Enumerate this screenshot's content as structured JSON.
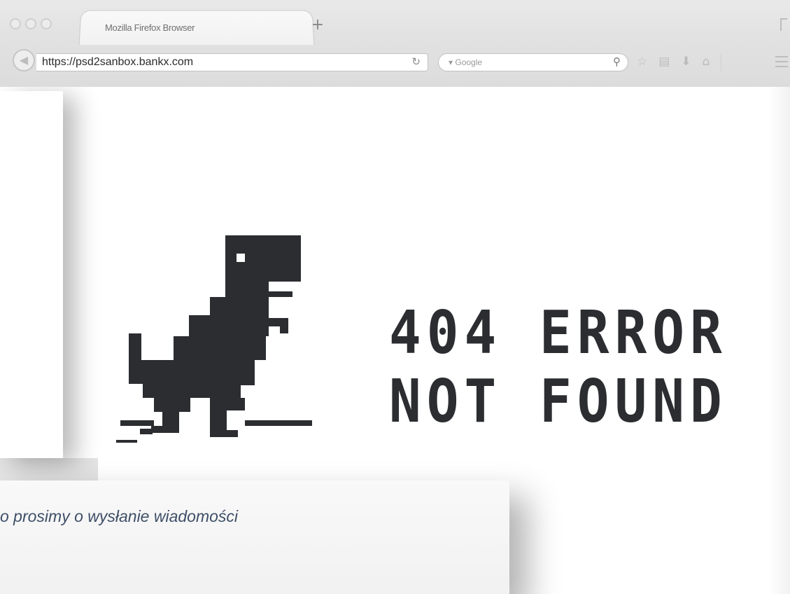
{
  "browser": {
    "tab_title": "Mozilla Firefox Browser",
    "new_tab_symbol": "+",
    "url": "https://psd2sanbox.bankx.com",
    "reload_symbol": "C",
    "search_placeholder": "Google",
    "search_engine_marker": "▾"
  },
  "toolbar_icons": [
    "star-icon",
    "bookmarks-icon",
    "download-icon",
    "home-icon",
    "menu-icon"
  ],
  "error": {
    "line1": "404 ERROR",
    "line2": "NOT FOUND"
  },
  "message": {
    "text": "o prosimy o wysłanie wiadomości"
  },
  "colors": {
    "dino": "#2b2d31",
    "message_text": "#3e4f68",
    "chrome_bg": "#e4e4e4"
  }
}
